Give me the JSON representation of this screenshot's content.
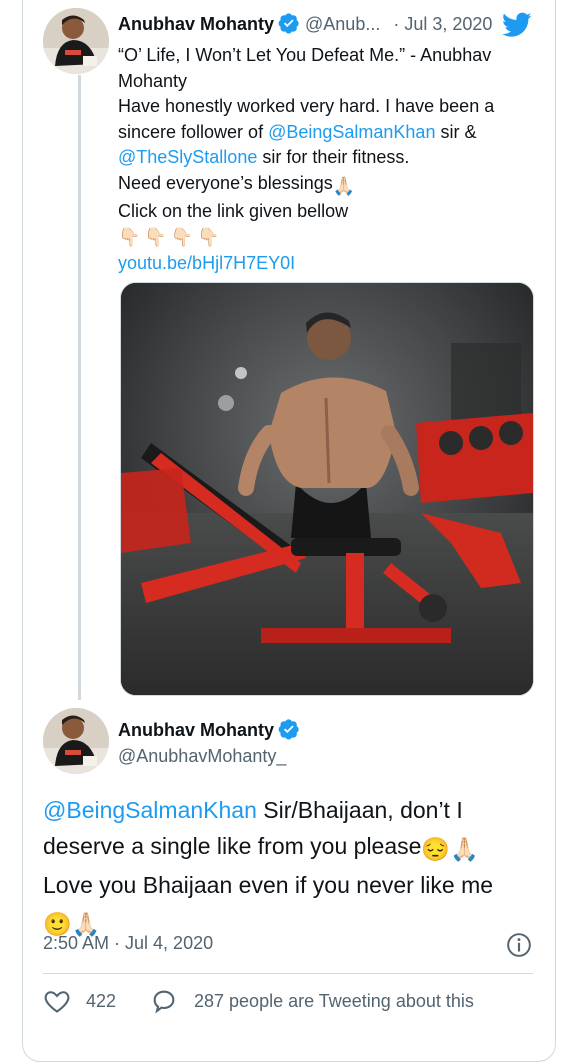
{
  "tweet1": {
    "name": "Anubhav Mohanty",
    "handle": "@Anub...",
    "date": "· Jul 3, 2020",
    "lines": [
      "“O’ Life, I Won’t Let You Defeat Me.” - Anubhav Mohanty",
      "Have honestly worked very hard. I have been a sincere follower of "
    ],
    "mention1": "@BeingSalmanKhan",
    "mid_text": " sir & ",
    "mention2": "@TheSlyStallone",
    "after_mention2": " sir for their fitness.",
    "blessings": "Need everyone’s blessings",
    "click_line": "Click on the link given bellow",
    "link": "youtu.be/bHjl7H7EY0I"
  },
  "tweet2": {
    "name": "Anubhav Mohanty",
    "handle": "@AnubhavMohanty_",
    "mention": "@BeingSalmanKhan",
    "text1": " Sir/Bhaijaan, don’t I deserve a single like from you please",
    "text2": "Love you Bhaijaan even if you never like me",
    "time": "2:50 AM · Jul 4, 2020",
    "likes": "422",
    "tweeting": "287 people are Tweeting about this"
  },
  "colors": {
    "accent": "#1d9bf0",
    "grey": "#536471",
    "border": "#cfd9de"
  },
  "icons": [
    "verified-badge-icon",
    "twitter-bird-icon",
    "info-icon",
    "heart-icon",
    "reply-icon"
  ]
}
